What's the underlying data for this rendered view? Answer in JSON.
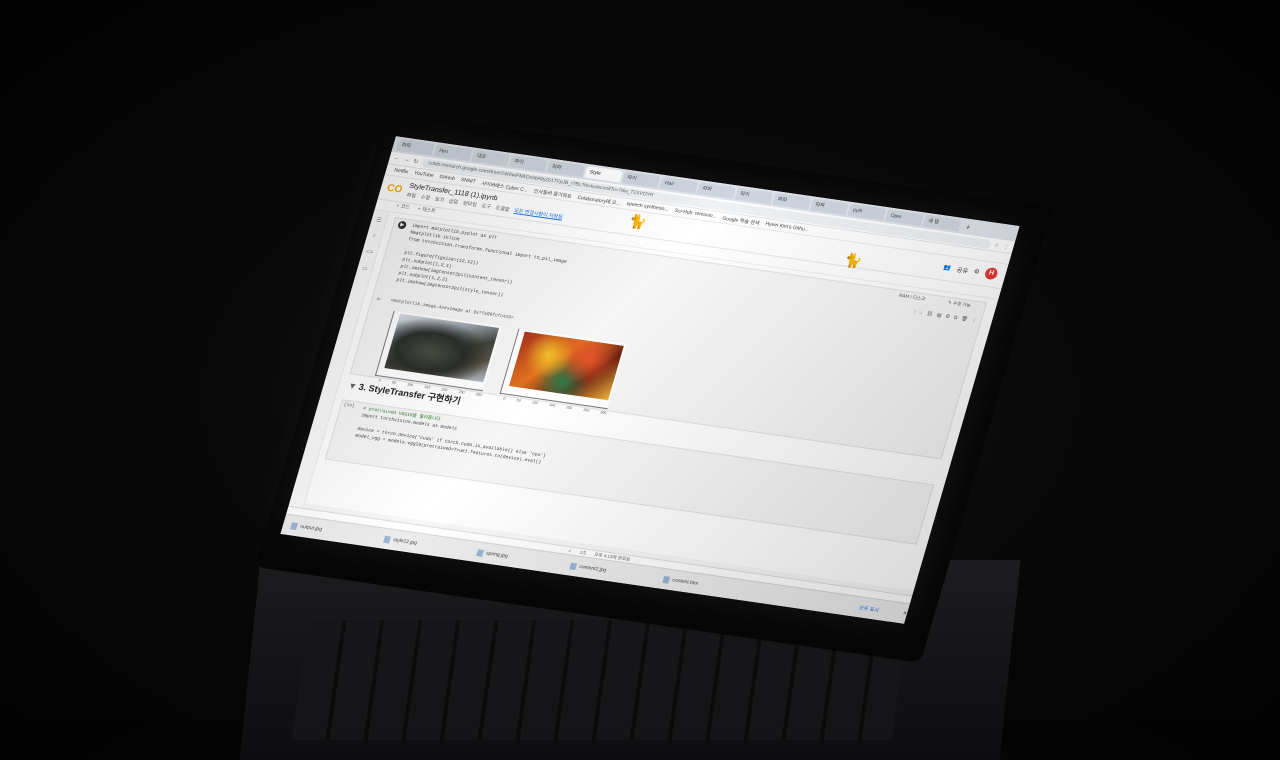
{
  "browser": {
    "tabs": [
      "파파",
      "Hyu",
      "대조",
      "파이",
      "파파",
      "Style",
      "파이",
      "Hair",
      "파파",
      "파이",
      "파파",
      "파파",
      "pyth",
      "Oper",
      "새 탭"
    ],
    "active_tab_index": 5,
    "url": "colab.research.google.com/drive/1W9wiFMkDmtbRbjZ61TFpJB_r?BL?hl=ko#scrollTo=?dw_T1XVOYR",
    "bookmarks": [
      "Netflix",
      "YouTube",
      "GitHub",
      "SNNIT",
      "사이버배스 Cyber C...",
      "인사들러 즐거워요",
      "Colaboratory에 오...",
      "speech synthesis...",
      "Sci-Hub: removin...",
      "Google 학술 검색",
      "Hyein Kim's Githu..."
    ]
  },
  "colab": {
    "logo": "CO",
    "title": "StyleTransfer_1118 (1).ipynb",
    "menu": [
      "파일",
      "수정",
      "보기",
      "삽입",
      "런타임",
      "도구",
      "도움말"
    ],
    "save_note": "모든 변경사항이 저장됨",
    "share_label": "공유",
    "avatar_letter": "H",
    "toolbar": [
      "+ 코드",
      "+ 텍스트"
    ],
    "ram_label": "RAM",
    "disk_label": "디스크",
    "edit_label": "수정 가능"
  },
  "cell1": {
    "code_lines": [
      "import matplotlib.pyplot as plt",
      "%matplotlib inline",
      "from torchvision.transforms.functional import to_pil_image",
      "",
      "plt.figure(figsize=(12,12))",
      "plt.subplot(1,2,1)",
      "plt.imshow(imgtensor2pil(content_tensor))",
      "plt.subplot(1,2,2)",
      "plt.imshow(imgtensor2pil(style_tensor))"
    ],
    "output": "<matplotlib.image.AxesImage at 0x7fa99fcfc410>",
    "x_ticks": [
      "0",
      "50",
      "100",
      "150",
      "200",
      "250",
      "300"
    ]
  },
  "section": {
    "title": "3. StyleTransfer 구현하기"
  },
  "cell2": {
    "exec_count": "[14]",
    "code_lines": [
      "# pretrained VGG19를 불러옵니다",
      "import torchvision.models as models",
      "",
      "device = torch.device('cuda' if torch.cuda.is_available() else 'cpu')",
      "model_vgg = models.vgg19(pretrained=True).features.to(device).eval()"
    ]
  },
  "status": {
    "elapsed": "1초",
    "completed": "오후 4:13에 완료됨"
  },
  "downloads": {
    "items": [
      "output.jpg",
      "style22.jpg",
      "spring.jpg",
      "content2.jpg",
      "content.htm"
    ],
    "show_all": "모두 표시"
  }
}
